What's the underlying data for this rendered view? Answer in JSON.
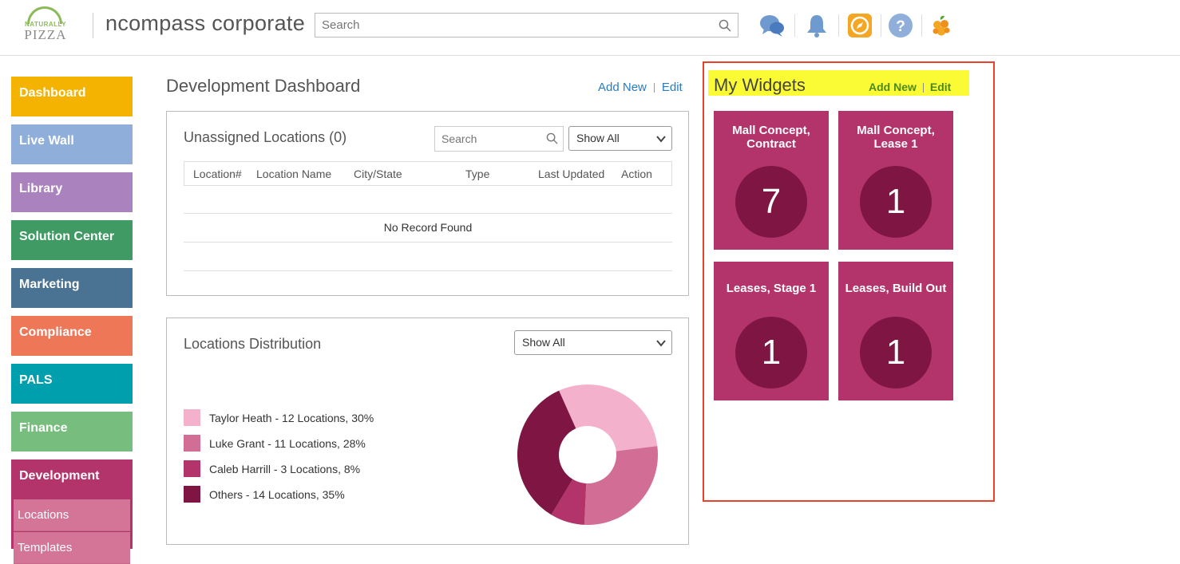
{
  "header": {
    "logo": {
      "line1": "NATURALLY",
      "line2": "PIZZA"
    },
    "brand": "ncompass corporate",
    "search_placeholder": "Search"
  },
  "sidebar": {
    "items": [
      {
        "label": "Dashboard",
        "color": "#f4b300"
      },
      {
        "label": "Live Wall",
        "color": "#8faed9"
      },
      {
        "label": "Library",
        "color": "#a982be"
      },
      {
        "label": "Solution Center",
        "color": "#3f9a63"
      },
      {
        "label": "Marketing",
        "color": "#4a7393"
      },
      {
        "label": "Compliance",
        "color": "#ee7758"
      },
      {
        "label": "PALS",
        "color": "#009fad"
      },
      {
        "label": "Finance",
        "color": "#76bd7e"
      },
      {
        "label": "Development",
        "color": "#b3336b"
      }
    ],
    "sub_items": [
      "Locations",
      "Templates"
    ]
  },
  "main": {
    "title": "Development Dashboard",
    "add_new": "Add New",
    "edit": "Edit",
    "unassigned": {
      "title": "Unassigned Locations (0)",
      "search_placeholder": "Search",
      "filter": "Show All",
      "columns": [
        "Location#",
        "Location Name",
        "City/State",
        "Type",
        "Last Updated",
        "Action"
      ],
      "empty": "No Record Found"
    },
    "distribution": {
      "title": "Locations Distribution",
      "filter": "Show All",
      "legend": [
        {
          "label": "Taylor Heath - 12 Locations, 30%",
          "color": "#f4b1cc",
          "value": 30
        },
        {
          "label": "Luke Grant - 11 Locations, 28%",
          "color": "#d26e96",
          "value": 28
        },
        {
          "label": "Caleb Harrill - 3 Locations, 8%",
          "color": "#b3336b",
          "value": 8
        },
        {
          "label": "Others - 14 Locations, 35%",
          "color": "#7e1543",
          "value": 35
        }
      ]
    }
  },
  "widgets": {
    "title": "My Widgets",
    "add_new": "Add New",
    "edit": "Edit",
    "tiles": [
      {
        "name": "Mall Concept, Contract",
        "count": "7"
      },
      {
        "name": "Mall Concept, Lease 1",
        "count": "1"
      },
      {
        "name": "Leases, Stage 1",
        "count": "1"
      },
      {
        "name": "Leases, Build Out",
        "count": "1"
      }
    ]
  }
}
